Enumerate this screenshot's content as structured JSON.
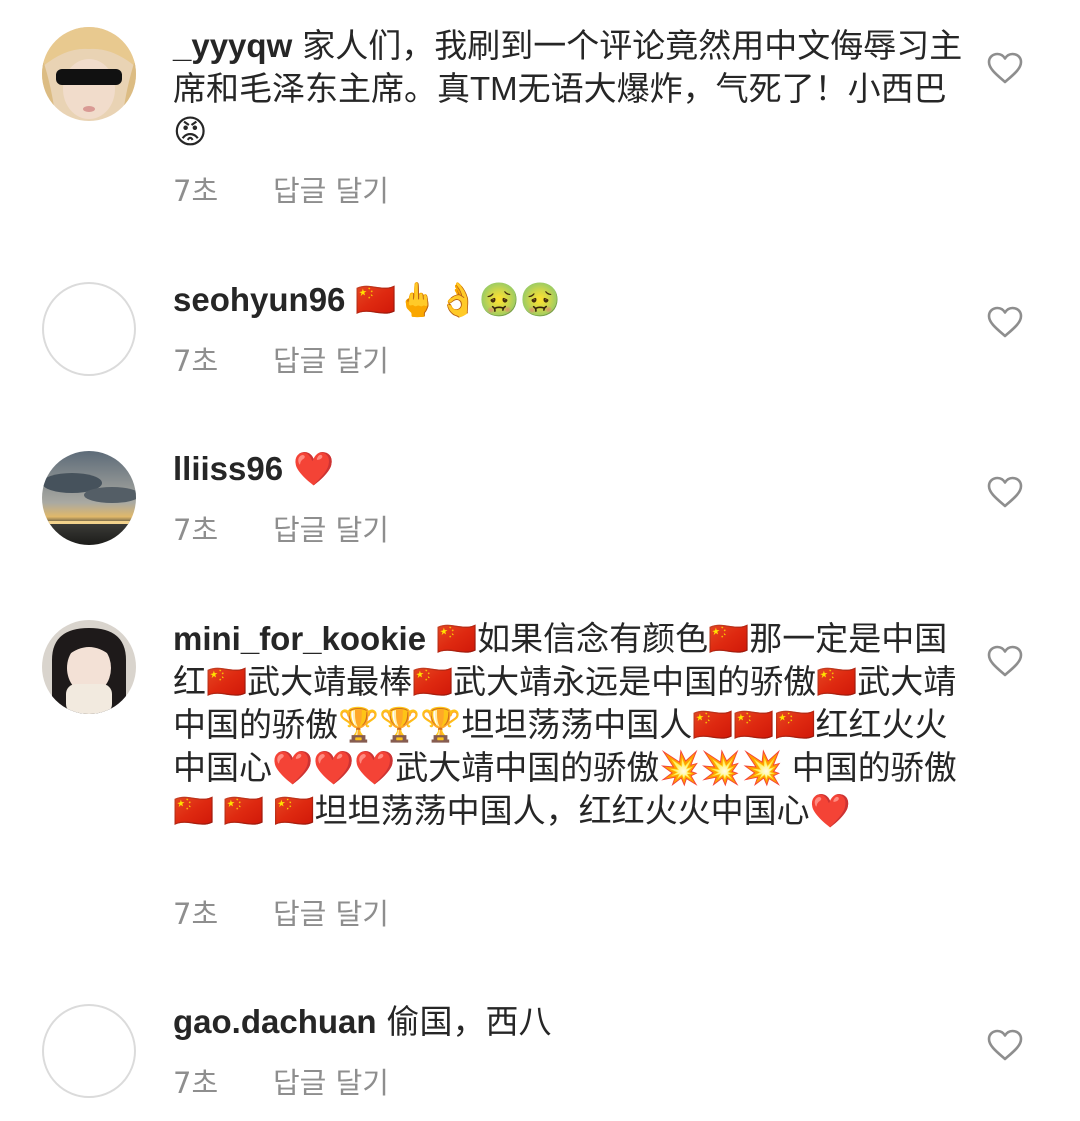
{
  "comments": [
    {
      "username": "_yyyqw",
      "text": "家人们，我刷到一个评论竟然用中文侮辱习主席和毛泽东主席。真TM无语大爆炸，气死了！小西巴😡",
      "time": "7초",
      "reply": "답글 달기",
      "avatar": "photo"
    },
    {
      "username": "seohyun96",
      "text": "🇨🇳🖕👌🤢🤢",
      "time": "7초",
      "reply": "답글 달기",
      "avatar": "empty"
    },
    {
      "username": "lliiss96",
      "text": "❤️",
      "time": "7초",
      "reply": "답글 달기",
      "avatar": "photo"
    },
    {
      "username": "mini_for_kookie",
      "text": "🇨🇳如果信念有颜色🇨🇳那一定是中国红🇨🇳武大靖最棒🇨🇳武大靖永远是中国的骄傲🇨🇳武大靖中国的骄傲🏆🏆🏆坦坦荡荡中国人🇨🇳🇨🇳🇨🇳红红火火中国心❤️❤️❤️武大靖中国的骄傲💥💥💥 中国的骄傲🇨🇳 🇨🇳 🇨🇳坦坦荡荡中国人，红红火火中国心❤️",
      "time": "7초",
      "reply": "답글 달기",
      "avatar": "photo"
    },
    {
      "username": "gao.dachuan",
      "text": "偷国，西八",
      "time": "7초",
      "reply": "답글 달기",
      "avatar": "empty"
    }
  ],
  "icons": {
    "like": "heart-outline-icon"
  },
  "colors": {
    "text": "#262626",
    "secondary": "#8e8e8e",
    "avatar_border": "#dbdbdb"
  }
}
